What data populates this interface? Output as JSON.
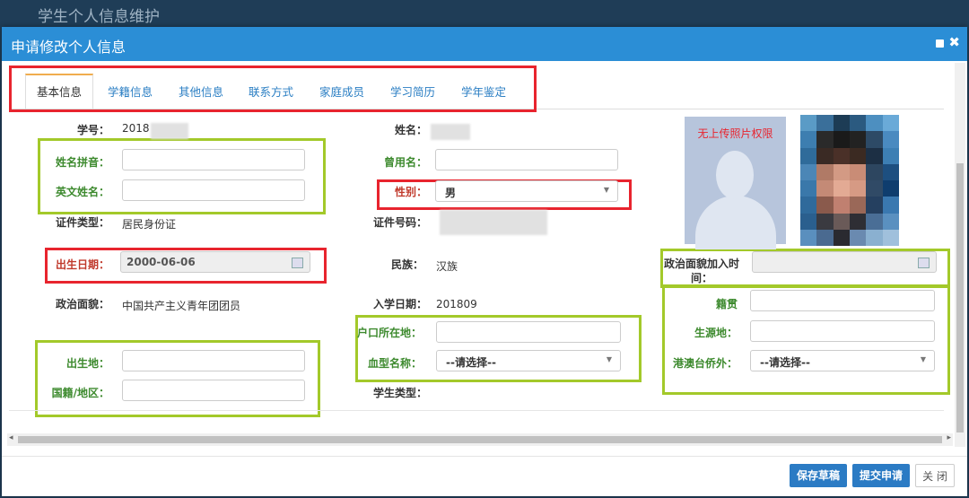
{
  "page": {
    "title": "学生个人信息维护"
  },
  "dialog": {
    "title": "申请修改个人信息"
  },
  "tabs": [
    "基本信息",
    "学籍信息",
    "其他信息",
    "联系方式",
    "家庭成员",
    "学习简历",
    "学年鉴定"
  ],
  "fields": {
    "student_id": {
      "label": "学号：",
      "value": "2018"
    },
    "name": {
      "label": "姓名："
    },
    "name_pinyin": {
      "label": "姓名拼音：",
      "value": ""
    },
    "former_name": {
      "label": "曾用名：",
      "value": ""
    },
    "english_name": {
      "label": "英文姓名：",
      "value": ""
    },
    "gender": {
      "label": "性别：",
      "value": "男"
    },
    "id_type": {
      "label": "证件类型：",
      "value": "居民身份证"
    },
    "id_number": {
      "label": "证件号码："
    },
    "birth_date": {
      "label": "出生日期：",
      "value": "2000-06-06"
    },
    "ethnicity": {
      "label": "民族：",
      "value": "汉族"
    },
    "party_join_time": {
      "label_1": "政治面貌加入时",
      "label_2": "间：",
      "value": ""
    },
    "political_status": {
      "label": "政治面貌：",
      "value": "中国共产主义青年团团员"
    },
    "enroll_date": {
      "label": "入学日期：",
      "value": "201809"
    },
    "native_place": {
      "label": "籍贯",
      "value": ""
    },
    "household": {
      "label": "户口所在地：",
      "value": ""
    },
    "origin_place": {
      "label": "生源地：",
      "value": ""
    },
    "birth_place": {
      "label": "出生地：",
      "value": ""
    },
    "blood_type": {
      "label": "血型名称：",
      "value": "--请选择--"
    },
    "hmt_overseas": {
      "label": "港澳台侨外：",
      "value": "--请选择--"
    },
    "nationality": {
      "label": "国籍/地区：",
      "value": ""
    },
    "student_type": {
      "label": "学生类型："
    }
  },
  "photo": {
    "no_permission_text": "无上传照片权限"
  },
  "buttons": {
    "save_draft": "保存草稿",
    "submit": "提交申请",
    "close": "关 闭"
  },
  "colors": {
    "header": "#2b8ed6",
    "primary_button": "#2b7bc4",
    "annotation_red": "#e8242e",
    "annotation_green": "#a3c92a"
  }
}
